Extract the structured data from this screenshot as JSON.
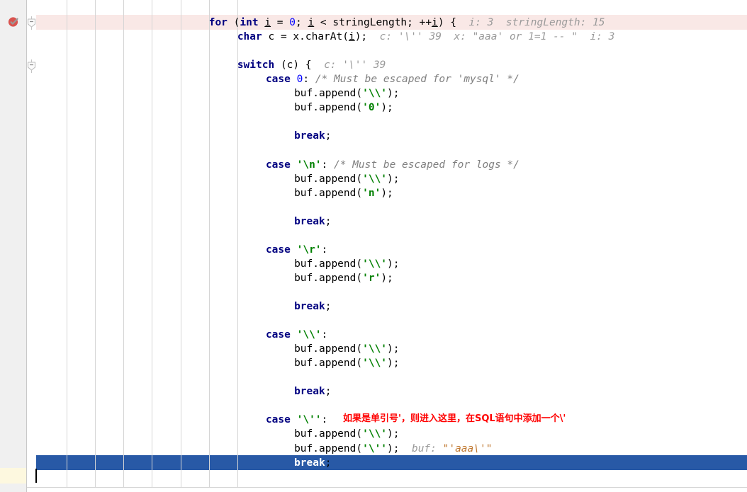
{
  "app": {
    "kind": "code-editor-debugger",
    "language": "java"
  },
  "colors": {
    "gutter_bg": "#f0f0f0",
    "gutter_border": "#c9c9c9",
    "breakpoint_line_highlight": "#f9e8e6",
    "selection_bg": "#2859a6",
    "selection_fg": "#ffffff",
    "caret_line_gutter": "#fdf8df",
    "keyword": "#000080",
    "number": "#0000ff",
    "string": "#008000",
    "comment": "#808080",
    "debug_hint": "#9a9a9a",
    "debug_hint_value": "#c07830",
    "annotation": "#ff0000",
    "indent_guide": "#d5d5d5",
    "breakpoint_icon": "#d9534f"
  },
  "gutter": {
    "breakpoint": {
      "icon": "breakpoint-verified-icon",
      "tooltip": "Breakpoint"
    },
    "fold_markers": [
      {
        "icon": "fold-collapse-icon",
        "line": 1
      },
      {
        "icon": "fold-collapse-icon",
        "line": 4
      }
    ]
  },
  "annotation": {
    "text": "如果是单引号'，则进入这里，在SQL语句中添加一个\\'"
  },
  "caret": {
    "line": 33,
    "column": 1
  },
  "code": {
    "lines": [
      {
        "indent": 6,
        "highlight": "breakpoint",
        "tokens": [
          {
            "t": "kw",
            "v": "for"
          },
          {
            "t": "plain",
            "v": " ("
          },
          {
            "t": "kw",
            "v": "int"
          },
          {
            "t": "plain",
            "v": " "
          },
          {
            "t": "var",
            "v": "i"
          },
          {
            "t": "plain",
            "v": " = "
          },
          {
            "t": "num",
            "v": "0"
          },
          {
            "t": "plain",
            "v": "; "
          },
          {
            "t": "var",
            "v": "i"
          },
          {
            "t": "plain",
            "v": " < stringLength; ++"
          },
          {
            "t": "var",
            "v": "i"
          },
          {
            "t": "plain",
            "v": ") {"
          },
          {
            "t": "hint",
            "v": "  i: 3  stringLength: 15"
          }
        ]
      },
      {
        "indent": 7,
        "tokens": [
          {
            "t": "kw",
            "v": "char"
          },
          {
            "t": "plain",
            "v": " c = x.charAt("
          },
          {
            "t": "var",
            "v": "i"
          },
          {
            "t": "plain",
            "v": ");"
          },
          {
            "t": "hint",
            "v": "  c: '\\'' 39  x: \"aaa' or 1=1 -- \"  i: 3"
          }
        ]
      },
      {
        "indent": 0,
        "tokens": []
      },
      {
        "indent": 7,
        "tokens": [
          {
            "t": "kw",
            "v": "switch"
          },
          {
            "t": "plain",
            "v": " (c) {"
          },
          {
            "t": "hint",
            "v": "  c: '\\'' 39"
          }
        ]
      },
      {
        "indent": 8,
        "tokens": [
          {
            "t": "kw",
            "v": "case"
          },
          {
            "t": "plain",
            "v": " "
          },
          {
            "t": "num",
            "v": "0"
          },
          {
            "t": "plain",
            "v": ": "
          },
          {
            "t": "cmt",
            "v": "/* Must be escaped for 'mysql' */"
          }
        ]
      },
      {
        "indent": 9,
        "tokens": [
          {
            "t": "plain",
            "v": "buf.append("
          },
          {
            "t": "str",
            "v": "'\\\\'"
          },
          {
            "t": "plain",
            "v": ");"
          }
        ]
      },
      {
        "indent": 9,
        "tokens": [
          {
            "t": "plain",
            "v": "buf.append("
          },
          {
            "t": "str",
            "v": "'0'"
          },
          {
            "t": "plain",
            "v": ");"
          }
        ]
      },
      {
        "indent": 0,
        "tokens": []
      },
      {
        "indent": 9,
        "tokens": [
          {
            "t": "kw",
            "v": "break"
          },
          {
            "t": "plain",
            "v": ";"
          }
        ]
      },
      {
        "indent": 0,
        "tokens": []
      },
      {
        "indent": 8,
        "tokens": [
          {
            "t": "kw",
            "v": "case"
          },
          {
            "t": "plain",
            "v": " "
          },
          {
            "t": "str",
            "v": "'\\n'"
          },
          {
            "t": "plain",
            "v": ": "
          },
          {
            "t": "cmt",
            "v": "/* Must be escaped for logs */"
          }
        ]
      },
      {
        "indent": 9,
        "tokens": [
          {
            "t": "plain",
            "v": "buf.append("
          },
          {
            "t": "str",
            "v": "'\\\\'"
          },
          {
            "t": "plain",
            "v": ");"
          }
        ]
      },
      {
        "indent": 9,
        "tokens": [
          {
            "t": "plain",
            "v": "buf.append("
          },
          {
            "t": "str",
            "v": "'n'"
          },
          {
            "t": "plain",
            "v": ");"
          }
        ]
      },
      {
        "indent": 0,
        "tokens": []
      },
      {
        "indent": 9,
        "tokens": [
          {
            "t": "kw",
            "v": "break"
          },
          {
            "t": "plain",
            "v": ";"
          }
        ]
      },
      {
        "indent": 0,
        "tokens": []
      },
      {
        "indent": 8,
        "tokens": [
          {
            "t": "kw",
            "v": "case"
          },
          {
            "t": "plain",
            "v": " "
          },
          {
            "t": "str",
            "v": "'\\r'"
          },
          {
            "t": "plain",
            "v": ":"
          }
        ]
      },
      {
        "indent": 9,
        "tokens": [
          {
            "t": "plain",
            "v": "buf.append("
          },
          {
            "t": "str",
            "v": "'\\\\'"
          },
          {
            "t": "plain",
            "v": ");"
          }
        ]
      },
      {
        "indent": 9,
        "tokens": [
          {
            "t": "plain",
            "v": "buf.append("
          },
          {
            "t": "str",
            "v": "'r'"
          },
          {
            "t": "plain",
            "v": ");"
          }
        ]
      },
      {
        "indent": 0,
        "tokens": []
      },
      {
        "indent": 9,
        "tokens": [
          {
            "t": "kw",
            "v": "break"
          },
          {
            "t": "plain",
            "v": ";"
          }
        ]
      },
      {
        "indent": 0,
        "tokens": []
      },
      {
        "indent": 8,
        "tokens": [
          {
            "t": "kw",
            "v": "case"
          },
          {
            "t": "plain",
            "v": " "
          },
          {
            "t": "str",
            "v": "'\\\\'"
          },
          {
            "t": "plain",
            "v": ":"
          }
        ]
      },
      {
        "indent": 9,
        "tokens": [
          {
            "t": "plain",
            "v": "buf.append("
          },
          {
            "t": "str",
            "v": "'\\\\'"
          },
          {
            "t": "plain",
            "v": ");"
          }
        ]
      },
      {
        "indent": 9,
        "tokens": [
          {
            "t": "plain",
            "v": "buf.append("
          },
          {
            "t": "str",
            "v": "'\\\\'"
          },
          {
            "t": "plain",
            "v": ");"
          }
        ]
      },
      {
        "indent": 0,
        "tokens": []
      },
      {
        "indent": 9,
        "tokens": [
          {
            "t": "kw",
            "v": "break"
          },
          {
            "t": "plain",
            "v": ";"
          }
        ]
      },
      {
        "indent": 0,
        "tokens": []
      },
      {
        "indent": 8,
        "tokens": [
          {
            "t": "kw",
            "v": "case"
          },
          {
            "t": "plain",
            "v": " "
          },
          {
            "t": "str",
            "v": "'\\''"
          },
          {
            "t": "plain",
            "v": ":"
          }
        ]
      },
      {
        "indent": 9,
        "tokens": [
          {
            "t": "plain",
            "v": "buf.append("
          },
          {
            "t": "str",
            "v": "'\\\\'"
          },
          {
            "t": "plain",
            "v": ");"
          }
        ]
      },
      {
        "indent": 9,
        "tokens": [
          {
            "t": "plain",
            "v": "buf.append("
          },
          {
            "t": "str",
            "v": "'\\''"
          },
          {
            "t": "plain",
            "v": ");"
          },
          {
            "t": "hint",
            "v": "  buf: "
          },
          {
            "t": "hintv",
            "v": "\"'aaa\\'\""
          }
        ]
      },
      {
        "indent": 9,
        "highlight": "selection",
        "tokens": [
          {
            "t": "kw",
            "v": "break"
          },
          {
            "t": "plain",
            "v": ";"
          }
        ]
      }
    ]
  }
}
